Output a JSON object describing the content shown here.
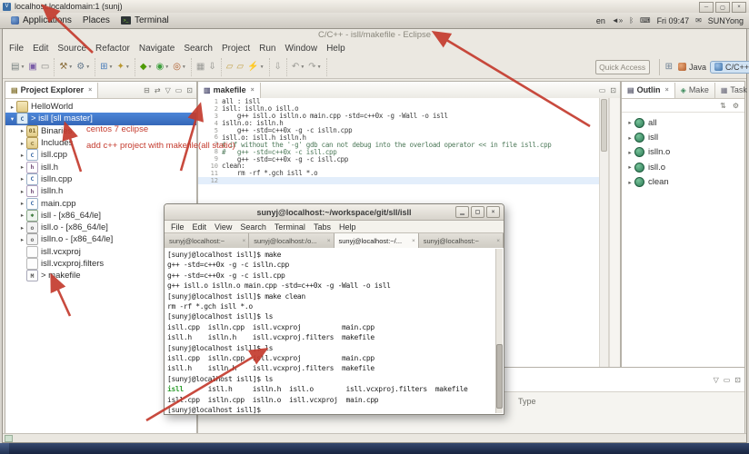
{
  "vnc": {
    "title": "localhost.localdomain:1 (sunj)",
    "icon_letter": "V",
    "buttons": [
      "─",
      "▢",
      "×"
    ]
  },
  "gnome": {
    "menus": [
      {
        "label": "Applications"
      },
      {
        "label": "Places"
      },
      {
        "label": "Terminal"
      }
    ],
    "tray": {
      "lang": "en",
      "speaker": "◄»",
      "bluetooth": "ᛒ",
      "input": "⌨",
      "clock": "Fri 09:47",
      "mail": "✉",
      "user": "SUNYong"
    }
  },
  "eclipse": {
    "window_title": "C/C++ - isll/makefile - Eclipse",
    "menus": [
      "File",
      "Edit",
      "Source",
      "Refactor",
      "Navigate",
      "Search",
      "Project",
      "Run",
      "Window",
      "Help"
    ],
    "toolbar_groups": [
      [
        {
          "name": "new-wizard",
          "g": "▤",
          "c": "#76807f",
          "caret": true
        },
        {
          "name": "save",
          "g": "▣",
          "c": "#7b5ea7",
          "caret": false
        },
        {
          "name": "print",
          "g": "▭",
          "c": "#8a8a86",
          "caret": false
        }
      ],
      [
        {
          "name": "build-all",
          "g": "⚒",
          "c": "#8a6d3b",
          "caret": true
        },
        {
          "name": "build-config",
          "g": "⚙",
          "c": "#667a8e",
          "caret": true
        }
      ],
      [
        {
          "name": "new-cpp-class",
          "g": "⊞",
          "c": "#4a7dbb",
          "caret": true
        },
        {
          "name": "search-c",
          "g": "✦",
          "c": "#b9972f",
          "caret": true
        }
      ],
      [
        {
          "name": "debug",
          "g": "◆",
          "c": "#4e9a06",
          "caret": true
        },
        {
          "name": "run",
          "g": "◉",
          "c": "#3c9e3c",
          "caret": true
        },
        {
          "name": "profile",
          "g": "◎",
          "c": "#b05c2a",
          "caret": true
        }
      ],
      [
        {
          "name": "mark-occurrences",
          "g": "▦",
          "c": "#9a9a96",
          "caret": false
        },
        {
          "name": "next-annotation",
          "g": "⇩",
          "c": "#8a8a86",
          "caret": false
        }
      ],
      [
        {
          "name": "open-resource",
          "g": "▱",
          "c": "#c3a24a",
          "caret": false
        },
        {
          "name": "open-folder",
          "g": "▱",
          "c": "#c3a24a",
          "caret": false
        },
        {
          "name": "external-tools",
          "g": "⚡",
          "c": "#caa23c",
          "caret": true
        }
      ],
      [
        {
          "name": "pin-editor",
          "g": "⇩",
          "c": "#9a9a94",
          "caret": false
        }
      ],
      [
        {
          "name": "back",
          "g": "↶",
          "c": "#9a9a94",
          "caret": true
        },
        {
          "name": "forward",
          "g": "↷",
          "c": "#9a9a94",
          "caret": true
        }
      ]
    ],
    "quick_access": "Quick Access",
    "perspective_open_icon": "⊞",
    "perspectives": [
      {
        "label": "Java",
        "active": false
      },
      {
        "label": "C/C++",
        "active": true
      }
    ],
    "explorer": {
      "title": "Project Explorer",
      "close_glyph": "×",
      "header_icons": [
        "⊟",
        "⇄",
        "▽",
        "▭",
        "⊡"
      ],
      "items": [
        {
          "label": "HelloWorld",
          "depth": 0,
          "exp": "▸",
          "icon": "project",
          "selected": false
        },
        {
          "label": "> isll [sll master]",
          "depth": 0,
          "exp": "▾",
          "icon": "cproject",
          "selected": true
        },
        {
          "label": "Binaries",
          "depth": 1,
          "exp": "▸",
          "icon": "binfolder",
          "selected": false
        },
        {
          "label": "Includes",
          "depth": 1,
          "exp": "▸",
          "icon": "incfolder",
          "selected": false
        },
        {
          "label": "isll.cpp",
          "depth": 1,
          "exp": "▸",
          "icon": "cpp",
          "selected": false
        },
        {
          "label": "isll.h",
          "depth": 1,
          "exp": "▸",
          "icon": "h",
          "selected": false
        },
        {
          "label": "islln.cpp",
          "depth": 1,
          "exp": "▸",
          "icon": "cpp",
          "selected": false
        },
        {
          "label": "islln.h",
          "depth": 1,
          "exp": "▸",
          "icon": "h",
          "selected": false
        },
        {
          "label": "main.cpp",
          "depth": 1,
          "exp": "▸",
          "icon": "cpp",
          "selected": false
        },
        {
          "label": "isll - [x86_64/le]",
          "depth": 1,
          "exp": "▸",
          "icon": "binary",
          "selected": false
        },
        {
          "label": "isll.o - [x86_64/le]",
          "depth": 1,
          "exp": "▸",
          "icon": "obj",
          "selected": false
        },
        {
          "label": "islln.o - [x86_64/le]",
          "depth": 1,
          "exp": "▸",
          "icon": "obj",
          "selected": false
        },
        {
          "label": "isll.vcxproj",
          "depth": 1,
          "exp": "",
          "icon": "file",
          "selected": false
        },
        {
          "label": "isll.vcxproj.filters",
          "depth": 1,
          "exp": "",
          "icon": "file",
          "selected": false
        },
        {
          "label": "> makefile",
          "depth": 1,
          "exp": "",
          "icon": "makefile",
          "selected": false
        }
      ]
    },
    "editor": {
      "tab": "makefile",
      "close_glyph": "×",
      "window_icons": [
        "▭",
        "⊡"
      ],
      "lines": [
        {
          "n": "1",
          "t": "all : isll",
          "cm": false,
          "cur": false
        },
        {
          "n": "2",
          "t": "isll: islln.o isll.o",
          "cm": false,
          "cur": false
        },
        {
          "n": "3",
          "t": "    g++ isll.o islln.o main.cpp -std=c++0x -g -Wall -o isll",
          "cm": false,
          "cur": false
        },
        {
          "n": "4",
          "t": "islln.o: islln.h",
          "cm": false,
          "cur": false
        },
        {
          "n": "5",
          "t": "    g++ -std=c++0x -g -c islln.cpp",
          "cm": false,
          "cur": false
        },
        {
          "n": "6",
          "t": "isll.o: isll.h islln.h",
          "cm": false,
          "cur": false
        },
        {
          "n": "7",
          "t": "# if without the '-g' gdb can not debug into the overload operator << in file isll.cpp",
          "cm": true,
          "cur": false
        },
        {
          "n": "8",
          "t": "#   g++ -std=c++0x -c isll.cpp",
          "cm": true,
          "cur": false
        },
        {
          "n": "9",
          "t": "    g++ -std=c++0x -g -c isll.cpp",
          "cm": false,
          "cur": false
        },
        {
          "n": "10",
          "t": "clean:",
          "cm": false,
          "cur": false
        },
        {
          "n": "11",
          "t": "    rm -rf *.gch isll *.o",
          "cm": false,
          "cur": false
        },
        {
          "n": "12",
          "t": "",
          "cm": false,
          "cur": true
        }
      ]
    },
    "outline": {
      "tabs": [
        {
          "label": "Outlin",
          "icon": "▤",
          "active": true
        },
        {
          "label": "Make",
          "icon": "◈",
          "active": false
        },
        {
          "label": "Task",
          "icon": "▦",
          "active": false
        }
      ],
      "toolbar_icons": [
        "⇅",
        "⚙"
      ],
      "items": [
        "all",
        "isll",
        "islln.o",
        "isll.o",
        "clean"
      ]
    },
    "problems": {
      "type_column": "Type",
      "header_icons": [
        "▽",
        "▭",
        "⊡"
      ]
    }
  },
  "terminal": {
    "title": "sunyj@localhost:~/workspace/git/sll/isll",
    "buttons": [
      "▁",
      "▢",
      "×"
    ],
    "menus": [
      "File",
      "Edit",
      "View",
      "Search",
      "Terminal",
      "Tabs",
      "Help"
    ],
    "tabs": [
      {
        "label": "sunyj@localhost:~",
        "active": false
      },
      {
        "label": "sunyj@localhost:/o...",
        "active": false
      },
      {
        "label": "sunyj@localhost:~/...",
        "active": true
      },
      {
        "label": "sunyj@localhost:~",
        "active": false
      }
    ],
    "lines": [
      [
        {
          "t": "[sunyj@localhost isll]$ make"
        }
      ],
      [
        {
          "t": "g++ -std=c++0x -g -c islln.cpp"
        }
      ],
      [
        {
          "t": "g++ -std=c++0x -g -c isll.cpp"
        }
      ],
      [
        {
          "t": "g++ isll.o islln.o main.cpp -std=c++0x -g -Wall -o isll"
        }
      ],
      [
        {
          "t": "[sunyj@localhost isll]$ make clean"
        }
      ],
      [
        {
          "t": "rm -rf *.gch isll *.o"
        }
      ],
      [
        {
          "t": "[sunyj@localhost isll]$ ls"
        }
      ],
      [
        {
          "t": "isll.cpp  islln.cpp  isll.vcxproj          main.cpp"
        }
      ],
      [
        {
          "t": "isll.h    islln.h    isll.vcxproj.filters  makefile"
        }
      ],
      [
        {
          "t": "[sunyj@localhost isll]$ ls"
        }
      ],
      [
        {
          "t": "isll.cpp  islln.cpp  isll.vcxproj          main.cpp"
        }
      ],
      [
        {
          "t": "isll.h    islln.h    isll.vcxproj.filters  makefile"
        }
      ],
      [
        {
          "t": "[sunyj@localhost isll]$ ls"
        }
      ],
      [
        {
          "t": "isll",
          "c": "exec"
        },
        {
          "t": "      isll.h     islln.h  isll.o        isll.vcxproj.filters  makefile"
        }
      ],
      [
        {
          "t": "isll.cpp  islln.cpp  islln.o  isll.vcxproj  main.cpp"
        }
      ],
      [
        {
          "t": "[sunyj@localhost isll]$"
        }
      ]
    ]
  },
  "annotations": {
    "note1": "centos 7 eclipse",
    "note2": "add c++ project with makefile(all static)",
    "arrow_color": "#c43b2e"
  },
  "colors": {
    "selection_blue": "#3c77c2",
    "terminal_exec_green": "#2f9e2f",
    "current_line_blue": "#e3eefb",
    "annotation_red": "#c43b2e"
  }
}
